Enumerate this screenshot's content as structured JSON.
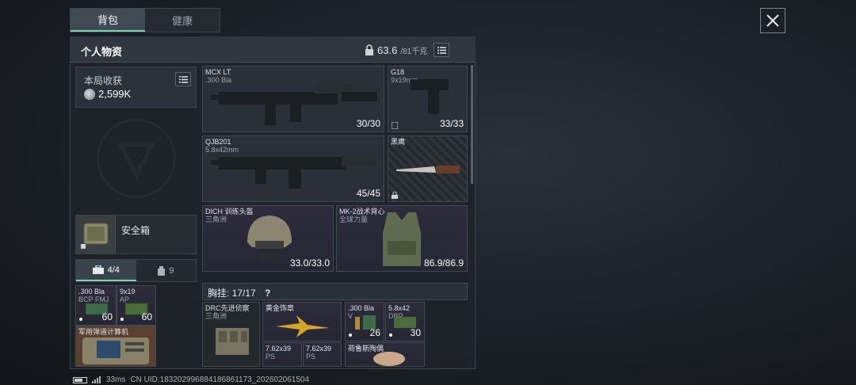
{
  "tabs": [
    {
      "label": "背包",
      "active": true
    },
    {
      "label": "健康",
      "active": false
    }
  ],
  "panel": {
    "title": "个人物资",
    "weight_value": "63.6",
    "weight_max": "/81千克"
  },
  "earnings": {
    "label": "本局收获",
    "value": "2,599K"
  },
  "safe_box": {
    "label": "安全箱"
  },
  "subtabs": [
    {
      "label": "4/4",
      "icon": "toolbox-icon",
      "active": true
    },
    {
      "label": "9",
      "icon": "bottle-icon",
      "active": false
    }
  ],
  "weapons": [
    {
      "name": "MCX LT",
      "sub": ".300 Bla",
      "count": "30/30",
      "icon": "rifle-mcx-icon"
    },
    {
      "name": "G18",
      "sub": "9x19mm",
      "count": "33/33",
      "icon": "pistol-g18-icon"
    },
    {
      "name": "QJB201",
      "sub": "5.8x42mm",
      "count": "45/45",
      "icon": "rifle-qjb-icon"
    },
    {
      "name": "黑鹰",
      "sub": "",
      "count": "",
      "icon": "knife-icon"
    }
  ],
  "gear": [
    {
      "name": "DICH 训练头盔",
      "sub": "三角洲",
      "count": "33.0/33.0",
      "icon": "helmet-icon"
    },
    {
      "name": "MK-2战术背心",
      "sub": "全球力量",
      "count": "86.9/86.9",
      "icon": "vest-icon"
    }
  ],
  "chest_rig": {
    "label": "胸挂: 17/17",
    "help": "?"
  },
  "rig_items": [
    {
      "name": "DRC先进侦察",
      "sub": "三角洲",
      "count": "",
      "icon": "rig-icon"
    },
    {
      "name": "黄金饰章",
      "sub": "",
      "count": "",
      "icon": "gold-badge-icon"
    },
    {
      "name": ".300 Bla",
      "sub": "V",
      "count": "26",
      "icon": "ammo-icon"
    },
    {
      "name": "5.8x42",
      "sub": "DBP",
      "count": "30",
      "icon": "ammo-box-icon"
    },
    {
      "name": "7.62x39",
      "sub": "PS",
      "count": "",
      "icon": "ammo-icon"
    },
    {
      "name": "7.62x39",
      "sub": "PS",
      "count": "",
      "icon": "ammo-icon"
    },
    {
      "name": "荷鲁斯陶偶",
      "sub": "",
      "count": "",
      "icon": "figurine-icon"
    }
  ],
  "pouch_items": [
    {
      "name": ".300 Bla",
      "sub": "BCP FMJ",
      "count": "60",
      "icon": "ammo-box-icon"
    },
    {
      "name": "9x19",
      "sub": "AP",
      "count": "60",
      "icon": "ammo-box-icon"
    },
    {
      "name": "军用弹道计算机",
      "sub": "",
      "count": "",
      "icon": "computer-icon"
    }
  ],
  "status_bar": {
    "ping": "33ms",
    "uid": "CN UID:18320299688418686​1173_202602061504"
  },
  "colors": {
    "accent": "#7fd3b8",
    "panel": "#1e2329",
    "text": "#e6e8ea"
  }
}
